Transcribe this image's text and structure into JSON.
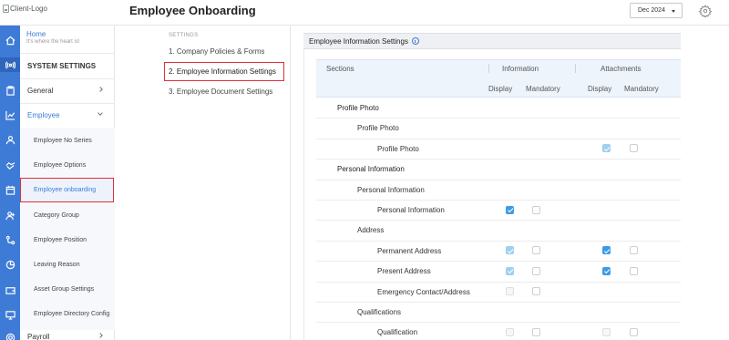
{
  "header": {
    "logo_alt": "Client-Logo",
    "title": "Employee Onboarding",
    "month": "Dec 2024"
  },
  "sidebar": {
    "home_title": "Home",
    "home_sub": "It's where the heart is!",
    "section_title": "SYSTEM SETTINGS",
    "general": "General",
    "employee": "Employee",
    "sub_items": [
      "Employee No Series",
      "Employee Options",
      "Employee onboarding",
      "Category Group",
      "Employee Position",
      "Leaving Reason",
      "Asset Group Settings",
      "Employee Directory Config"
    ],
    "payroll": "Payroll"
  },
  "settings_nav": {
    "label": "SETTINGS",
    "items": [
      "1. Company Policies & Forms",
      "2. Employee Information Settings",
      "3. Employee Document Settings"
    ]
  },
  "panel": {
    "title": "Employee Information Settings",
    "col_sections": "Sections",
    "col_information": "Information",
    "col_attachments": "Attachments",
    "display": "Display",
    "mandatory": "Mandatory"
  },
  "rows": [
    {
      "label": "Profile Photo",
      "level": 0
    },
    {
      "label": "Profile Photo",
      "level": 1
    },
    {
      "label": "Profile Photo",
      "level": 2,
      "info": null,
      "att": [
        "dis",
        "off"
      ]
    },
    {
      "label": "Personal Information",
      "level": 0
    },
    {
      "label": "Personal Information",
      "level": 1
    },
    {
      "label": "Personal Information",
      "level": 2,
      "info": [
        "on",
        "off"
      ],
      "att": null
    },
    {
      "label": "Address",
      "level": 1
    },
    {
      "label": "Permanent Address",
      "level": 2,
      "info": [
        "dis",
        "off"
      ],
      "att": [
        "on",
        "off"
      ]
    },
    {
      "label": "Present Address",
      "level": 2,
      "info": [
        "dis",
        "off"
      ],
      "att": [
        "on",
        "off"
      ]
    },
    {
      "label": "Emergency Contact/Address",
      "level": 2,
      "info": [
        "off-dis",
        "off"
      ],
      "att": null
    },
    {
      "label": "Qualifications",
      "level": 1
    },
    {
      "label": "Qualification",
      "level": 2,
      "info": [
        "off-dis",
        "off"
      ],
      "att": [
        "off-dis",
        "off"
      ]
    }
  ],
  "colors": {
    "accent": "#3e7bd6",
    "highlight_border": "#e0303b"
  }
}
